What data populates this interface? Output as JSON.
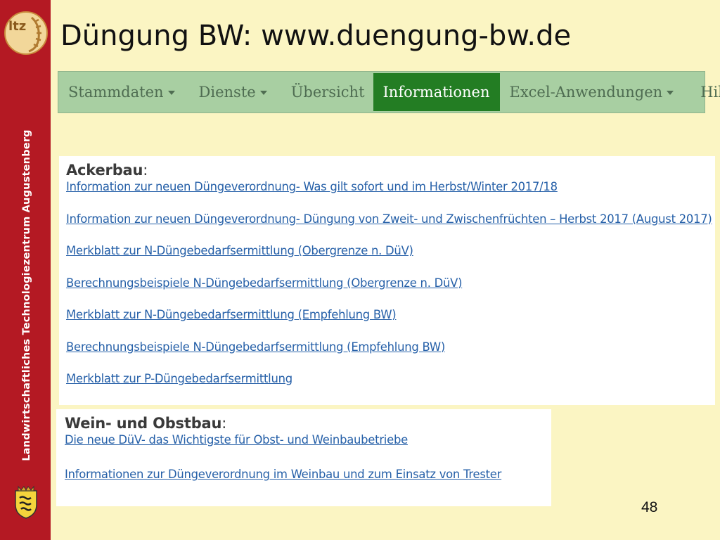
{
  "sidebar": {
    "logo_text": "ltz",
    "vertical_label": "Landwirtschaftliches Technologiezentrum Augustenberg"
  },
  "slide": {
    "title": "Düngung BW: www.duengung-bw.de",
    "page_number": "48"
  },
  "navbar": {
    "items": [
      {
        "label": "Stammdaten",
        "dropdown": true
      },
      {
        "label": "Dienste",
        "dropdown": true
      },
      {
        "label": "Übersicht",
        "dropdown": false
      },
      {
        "label": "Informationen",
        "dropdown": false,
        "active": true
      },
      {
        "label": "Excel-Anwendungen",
        "dropdown": true
      },
      {
        "label": "Hilfe",
        "dropdown": true
      }
    ]
  },
  "ackerbau": {
    "heading": "Ackerbau",
    "links": [
      "Information zur neuen Düngeverordnung- Was gilt sofort und im Herbst/Winter 2017/18",
      "Information zur neuen Düngeverordnung- Düngung von Zweit- und Zwischenfrüchten – Herbst 2017 (August 2017)",
      "Merkblatt zur N-Düngebedarfsermittlung (Obergrenze n. DüV)",
      "Berechnungsbeispiele N-Düngebedarfsermittlung (Obergrenze n. DüV)",
      "Merkblatt zur N-Düngebedarfsermittlung (Empfehlung BW)",
      "Berechnungsbeispiele N-Düngebedarfsermittlung (Empfehlung BW)",
      "Merkblatt zur P-Düngebedarfsermittlung"
    ]
  },
  "weinobst": {
    "heading": "Wein- und Obstbau",
    "links": [
      "Die neue DüV- das Wichtigste für Obst- und Weinbaubetriebe",
      "Informationen zur Düngeverordnung im Weinbau und zum Einsatz von Trester"
    ]
  },
  "colors": {
    "sidebar": "#b41923",
    "background": "#fbf5c3",
    "navbar": "#a8cfa2",
    "nav_active": "#237d23",
    "link": "#2660a8"
  }
}
